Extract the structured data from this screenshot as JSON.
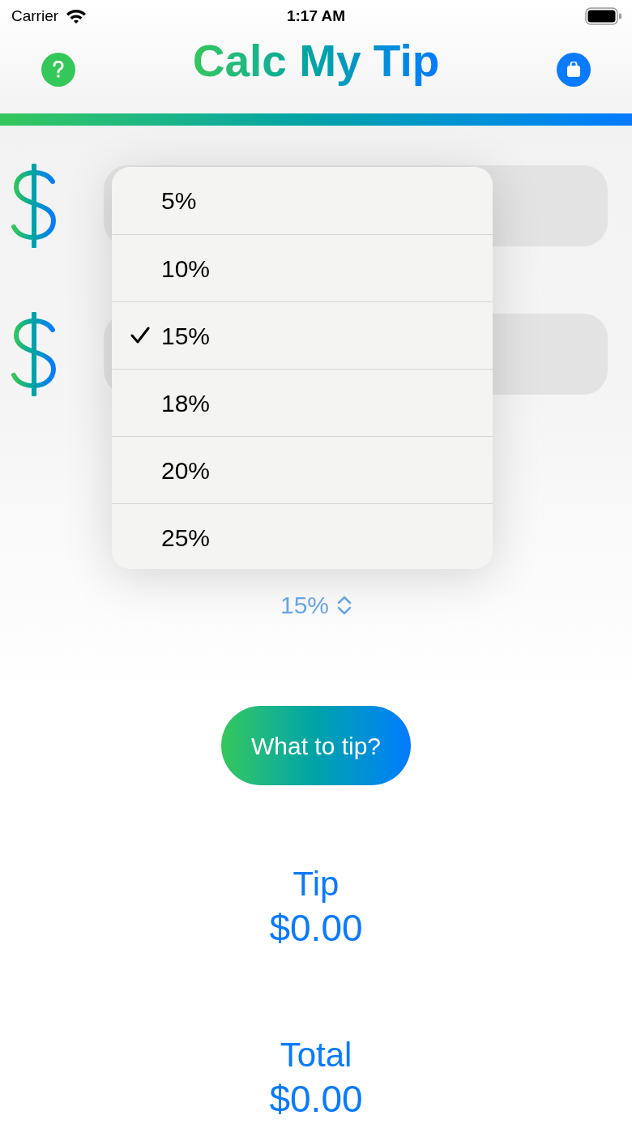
{
  "status_bar": {
    "carrier": "Carrier",
    "time": "1:17 AM"
  },
  "header": {
    "title": "Calc My Tip"
  },
  "tip_menu": {
    "items": [
      {
        "label": "5%",
        "selected": false
      },
      {
        "label": "10%",
        "selected": false
      },
      {
        "label": "15%",
        "selected": true
      },
      {
        "label": "18%",
        "selected": false
      },
      {
        "label": "20%",
        "selected": false
      },
      {
        "label": "25%",
        "selected": false
      }
    ]
  },
  "tip_picker": {
    "value": "15%"
  },
  "action_button": {
    "label": "What to tip?"
  },
  "results": [
    {
      "label": "Tip",
      "value": "$0.00"
    },
    {
      "label": "Total",
      "value": "$0.00"
    }
  ]
}
